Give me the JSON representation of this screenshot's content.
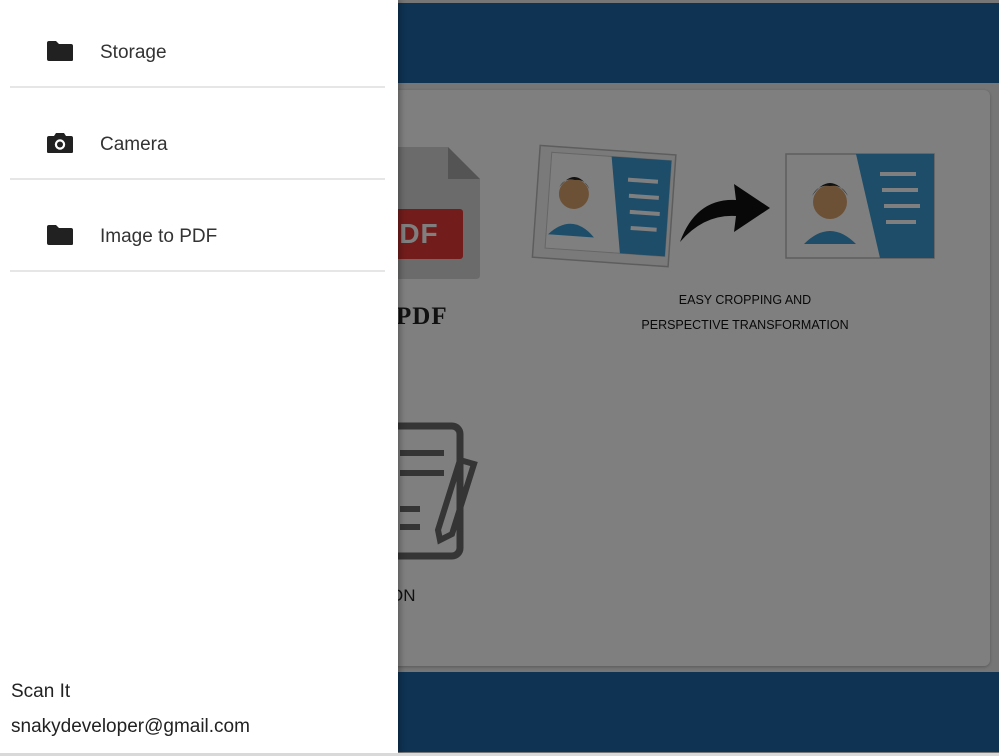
{
  "drawer": {
    "items": [
      {
        "label": "Storage",
        "icon": "folder-icon"
      },
      {
        "label": "Camera",
        "icon": "camera-icon"
      },
      {
        "label": "Image to PDF",
        "icon": "folder-icon"
      }
    ],
    "footer": {
      "app_name": "Scan It",
      "email": "snakydeveloper@gmail.com"
    }
  },
  "background": {
    "pdf_badge": "DF",
    "pdf_title": "PDF",
    "crop_caption_line1": "EASY CROPPING AND",
    "crop_caption_line2": "PERSPECTIVE TRANSFORMATION",
    "partial_label": "ON"
  },
  "colors": {
    "header": "#1c66a6",
    "pdf_red": "#e53a37",
    "card_blue": "#3b9ad1",
    "scrim": "rgba(0,0,0,0.5)"
  }
}
